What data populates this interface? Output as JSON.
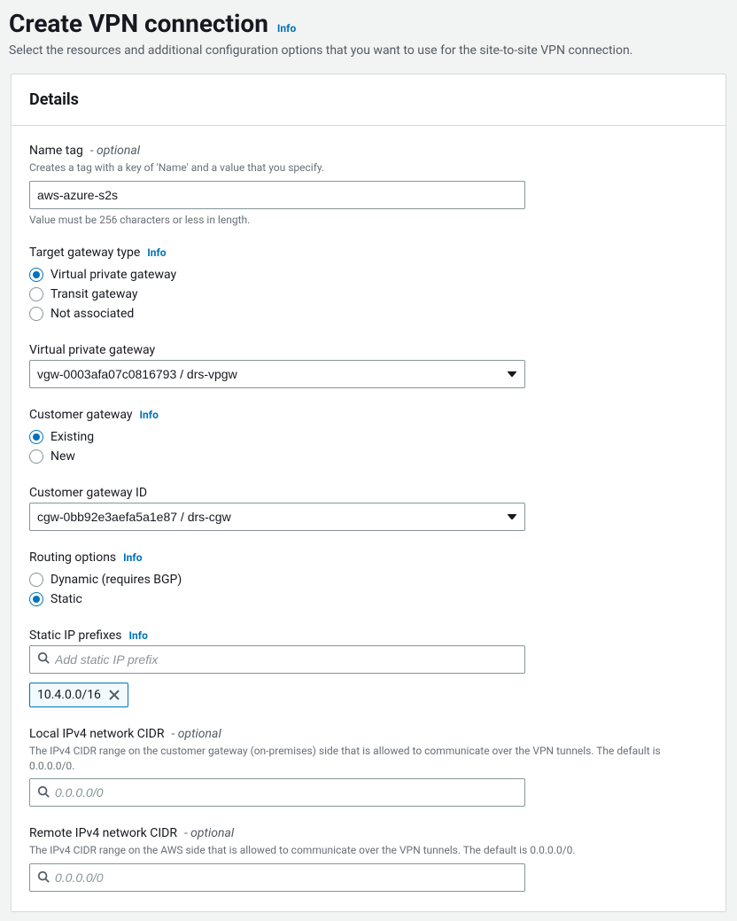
{
  "page": {
    "title": "Create VPN connection",
    "info": "Info",
    "desc": "Select the resources and additional configuration options that you want to use for the site-to-site VPN connection."
  },
  "details": {
    "header": "Details"
  },
  "nameTag": {
    "label": "Name tag",
    "optional": "- optional",
    "helper": "Creates a tag with a key of 'Name' and a value that you specify.",
    "value": "aws-azure-s2s",
    "constraint": "Value must be 256 characters or less in length."
  },
  "targetGateway": {
    "label": "Target gateway type",
    "info": "Info",
    "options": {
      "vpg": "Virtual private gateway",
      "tgw": "Transit gateway",
      "none": "Not associated"
    }
  },
  "vpg": {
    "label": "Virtual private gateway",
    "selected": "vgw-0003afa07c0816793 / drs-vpgw"
  },
  "customerGateway": {
    "label": "Customer gateway",
    "info": "Info",
    "options": {
      "existing": "Existing",
      "new": "New"
    }
  },
  "cgwId": {
    "label": "Customer gateway ID",
    "selected": "cgw-0bb92e3aefa5a1e87 / drs-cgw"
  },
  "routing": {
    "label": "Routing options",
    "info": "Info",
    "options": {
      "dynamic": "Dynamic (requires BGP)",
      "static": "Static"
    }
  },
  "staticPrefixes": {
    "label": "Static IP prefixes",
    "info": "Info",
    "placeholder": "Add static IP prefix",
    "token": "10.4.0.0/16"
  },
  "localCidr": {
    "label": "Local IPv4 network CIDR",
    "optional": "- optional",
    "helper": "The IPv4 CIDR range on the customer gateway (on-premises) side that is allowed to communicate over the VPN tunnels. The default is 0.0.0.0/0.",
    "placeholder": "0.0.0.0/0"
  },
  "remoteCidr": {
    "label": "Remote IPv4 network CIDR",
    "optional": "- optional",
    "helper": "The IPv4 CIDR range on the AWS side that is allowed to communicate over the VPN tunnels. The default is 0.0.0.0/0.",
    "placeholder": "0.0.0.0/0"
  }
}
